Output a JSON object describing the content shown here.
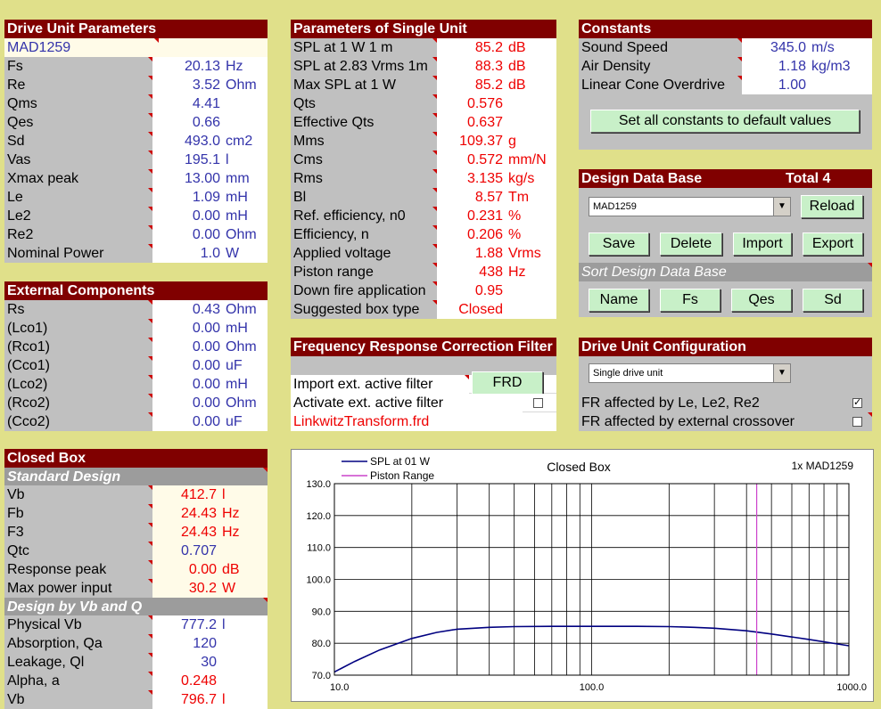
{
  "drive_unit": {
    "title": "Drive Unit Parameters",
    "model": "MAD1259",
    "rows": [
      {
        "label": "Fs",
        "value": "20.13",
        "unit": "Hz"
      },
      {
        "label": "Re",
        "value": "3.52",
        "unit": "Ohm"
      },
      {
        "label": "Qms",
        "value": "4.41",
        "unit": ""
      },
      {
        "label": "Qes",
        "value": "0.66",
        "unit": ""
      },
      {
        "label": "Sd",
        "value": "493.0",
        "unit": "cm2"
      },
      {
        "label": "Vas",
        "value": "195.1",
        "unit": "l"
      },
      {
        "label": "Xmax peak",
        "value": "13.00",
        "unit": "mm"
      },
      {
        "label": "Le",
        "value": "1.09",
        "unit": "mH"
      },
      {
        "label": "Le2",
        "value": "0.00",
        "unit": "mH"
      },
      {
        "label": "Re2",
        "value": "0.00",
        "unit": "Ohm"
      },
      {
        "label": "Nominal Power",
        "value": "1.0",
        "unit": "W"
      }
    ]
  },
  "external": {
    "title": "External Components",
    "rows": [
      {
        "label": "Rs",
        "value": "0.43",
        "unit": "Ohm"
      },
      {
        "label": "(Lco1)",
        "value": "0.00",
        "unit": "mH"
      },
      {
        "label": "(Rco1)",
        "value": "0.00",
        "unit": "Ohm"
      },
      {
        "label": "(Cco1)",
        "value": "0.00",
        "unit": "uF"
      },
      {
        "label": "(Lco2)",
        "value": "0.00",
        "unit": "mH"
      },
      {
        "label": "(Rco2)",
        "value": "0.00",
        "unit": "Ohm"
      },
      {
        "label": "(Cco2)",
        "value": "0.00",
        "unit": "uF"
      }
    ]
  },
  "closed_box": {
    "title": "Closed Box",
    "standard_title": "Standard Design",
    "standard_rows": [
      {
        "label": "Vb",
        "value": "412.7",
        "unit": "l",
        "color": "red"
      },
      {
        "label": "Fb",
        "value": "24.43",
        "unit": "Hz",
        "color": "red"
      },
      {
        "label": "F3",
        "value": "24.43",
        "unit": "Hz",
        "color": "red"
      },
      {
        "label": "Qtc",
        "value": "0.707",
        "unit": "",
        "color": "blue"
      },
      {
        "label": "Response peak",
        "value": "0.00",
        "unit": "dB",
        "color": "red"
      },
      {
        "label": "Max power input",
        "value": "30.2",
        "unit": "W",
        "color": "red"
      }
    ],
    "vbq_title": "Design by Vb and Q",
    "vbq_rows": [
      {
        "label": "Physical Vb",
        "value": "777.2",
        "unit": "l",
        "color": "blue"
      },
      {
        "label": "Absorption, Qa",
        "value": "120",
        "unit": "",
        "color": "blue"
      },
      {
        "label": "Leakage, Ql",
        "value": "30",
        "unit": "",
        "color": "blue"
      },
      {
        "label": "Alpha, a",
        "value": "0.248",
        "unit": "",
        "color": "red"
      },
      {
        "label": "Vb",
        "value": "796.7",
        "unit": "l",
        "color": "red"
      }
    ]
  },
  "single_unit": {
    "title": "Parameters of Single Unit",
    "rows": [
      {
        "label": "SPL at 1 W 1 m",
        "value": "85.2",
        "unit": "dB"
      },
      {
        "label": "SPL at 2.83 Vrms 1m",
        "value": "88.3",
        "unit": "dB"
      },
      {
        "label": "Max SPL at 1 W",
        "value": "85.2",
        "unit": "dB"
      },
      {
        "label": "Qts",
        "value": "0.576",
        "unit": ""
      },
      {
        "label": "Effective Qts",
        "value": "0.637",
        "unit": ""
      },
      {
        "label": "Mms",
        "value": "109.37",
        "unit": "g"
      },
      {
        "label": "Cms",
        "value": "0.572",
        "unit": "mm/N"
      },
      {
        "label": "Rms",
        "value": "3.135",
        "unit": "kg/s"
      },
      {
        "label": "Bl",
        "value": "8.57",
        "unit": "Tm"
      },
      {
        "label": "Ref. efficiency, n0",
        "value": "0.231",
        "unit": "%"
      },
      {
        "label": "Efficiency, n",
        "value": "0.206",
        "unit": "%"
      },
      {
        "label": "Applied voltage",
        "value": "1.88",
        "unit": "Vrms"
      },
      {
        "label": "Piston range",
        "value": "438",
        "unit": "Hz"
      },
      {
        "label": "Down fire application",
        "value": "0.95",
        "unit": ""
      },
      {
        "label": "Suggested box type",
        "value": "Closed",
        "unit": ""
      }
    ]
  },
  "frcf": {
    "title": "Frequency Response Correction Filter",
    "import_label": "Import ext. active filter",
    "frd_button": "FRD",
    "activate_label": "Activate ext. active filter",
    "filename": "LinkwitzTransform.frd"
  },
  "constants": {
    "title": "Constants",
    "rows": [
      {
        "label": "Sound Speed",
        "value": "345.0",
        "unit": "m/s"
      },
      {
        "label": "Air Density",
        "value": "1.18",
        "unit": "kg/m3"
      },
      {
        "label": "Linear Cone Overdrive",
        "value": "1.00",
        "unit": ""
      }
    ],
    "default_button": "Set all constants to default values"
  },
  "database": {
    "title": "Design Data Base",
    "total": "Total  4",
    "selected": "MAD1259",
    "reload": "Reload",
    "save": "Save",
    "delete": "Delete",
    "import": "Import",
    "export": "Export",
    "sort_title": "Sort Design Data Base",
    "sort_name": "Name",
    "sort_fs": "Fs",
    "sort_qes": "Qes",
    "sort_sd": "Sd"
  },
  "config": {
    "title": "Drive Unit Configuration",
    "selected": "Single drive unit",
    "fr_le_label": "FR affected by Le, Le2, Re2",
    "fr_le_checked": true,
    "fr_xover_label": "FR affected by external crossover",
    "fr_xover_checked": false
  },
  "chart_data": {
    "type": "line",
    "title": "Closed Box",
    "annotation": "1x MAD1259",
    "legend": [
      "SPL at 01 W",
      "Piston Range"
    ],
    "legend_position": "top-left",
    "x_scale": "log",
    "xlim": [
      10,
      1000
    ],
    "ylim": [
      70,
      130
    ],
    "x_ticks": [
      "10.0",
      "100.0",
      "1000.0"
    ],
    "y_ticks": [
      "70.0",
      "80.0",
      "90.0",
      "100.0",
      "110.0",
      "120.0",
      "130.0"
    ],
    "grid": true,
    "series": [
      {
        "name": "SPL at 01 W",
        "color": "#000080",
        "x": [
          10,
          12,
          15,
          20,
          25,
          30,
          40,
          50,
          70,
          100,
          150,
          200,
          250,
          300,
          400,
          500,
          700,
          1000
        ],
        "y": [
          71.0,
          74.3,
          77.9,
          81.5,
          83.4,
          84.4,
          85.0,
          85.2,
          85.3,
          85.3,
          85.3,
          85.2,
          85.0,
          84.7,
          83.9,
          82.9,
          81.2,
          79.2
        ]
      },
      {
        "name": "Piston Range",
        "color": "#cc44cc",
        "x": [
          438,
          438
        ],
        "y": [
          70,
          130
        ]
      }
    ]
  }
}
